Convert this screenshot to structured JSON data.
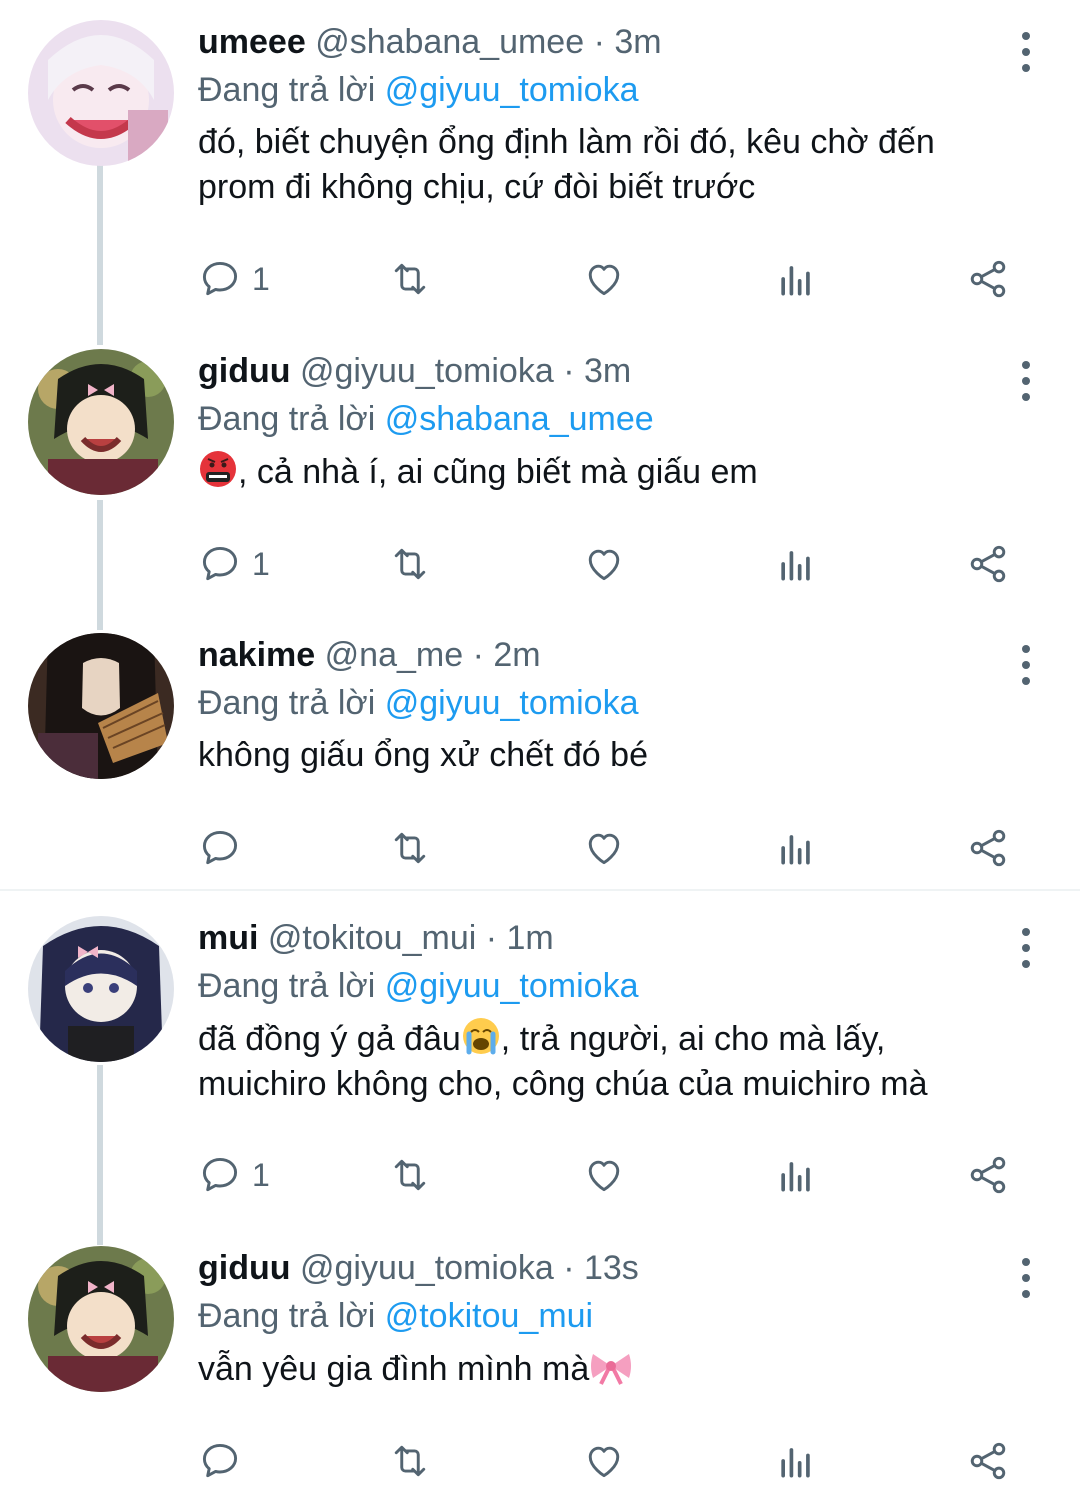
{
  "reply_prefix": "Đang trả lời",
  "tweets": [
    {
      "name": "umeee",
      "handle": "@shabana_umee",
      "dot": " · ",
      "time": "3m",
      "reply_to": "@giyuu_tomioka",
      "text_before": "đó, biết chuyện ổng định làm rồi đó, kêu chờ đến prom đi không chịu, cứ đòi biết trước",
      "text_after": "",
      "emoji": "",
      "reply_count": "1",
      "avatar_color": "#e9d6ec"
    },
    {
      "name": "giduu",
      "handle": "@giyuu_tomioka",
      "dot": " · ",
      "time": "3m",
      "reply_to": "@shabana_umee",
      "text_before": "",
      "text_after": ", cả nhà í, ai cũng biết mà giấu em",
      "emoji": "face-with-symbols-on-mouth",
      "reply_count": "1",
      "avatar_color": "#4a5a3a"
    },
    {
      "name": "nakime",
      "handle": "@na_me",
      "dot": " · ",
      "time": "2m",
      "reply_to": "@giyuu_tomioka",
      "text_before": "không giấu ổng xử chết đó bé",
      "text_after": "",
      "emoji": "",
      "reply_count": "",
      "avatar_color": "#2a2220"
    },
    {
      "name": "mui",
      "handle": "@tokitou_mui",
      "dot": " · ",
      "time": "1m",
      "reply_to": "@giyuu_tomioka",
      "text_before": "đã đồng ý gả đâu",
      "text_after": ", trả người, ai cho mà lấy, muichiro không cho, công chúa của muichiro mà",
      "emoji": "loudly-crying-face",
      "reply_count": "1",
      "avatar_color": "#2c2f55"
    },
    {
      "name": "giduu",
      "handle": "@giyuu_tomioka",
      "dot": " · ",
      "time": "13s",
      "reply_to": "@tokitou_mui",
      "text_before": "vẫn yêu gia đình mình mà",
      "text_after": "",
      "emoji": "ribbon",
      "reply_count": "",
      "avatar_color": "#4a5a3a"
    }
  ],
  "colors": {
    "link": "#1d9bf0",
    "secondary": "#536471",
    "thread_line": "#cfd9de"
  }
}
